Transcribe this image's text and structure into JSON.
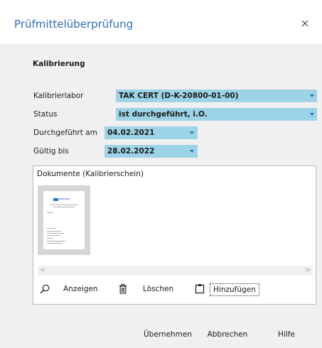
{
  "dialog": {
    "title": "Prüfmittelüberprüfung",
    "close_label": "×"
  },
  "section": {
    "title": "Kalibrierung"
  },
  "fields": {
    "kalibrierlabor": {
      "label": "Kalibrierlabor",
      "value": "TAK CERT (D-K-20800-01-00)"
    },
    "status": {
      "label": "Status",
      "value": "ist durchgeführt, i.O."
    },
    "durchgefuehrt_am": {
      "label": "Durchgeführt am",
      "value": "04.02.2021"
    },
    "gueltig_bis": {
      "label": "Gültig bis",
      "value": "28.02.2022"
    }
  },
  "documents": {
    "title": "Dokumente (Kalibrierschein)",
    "thumbnail_logo": "AZK Plus",
    "scroll_left": "<",
    "scroll_right": ">",
    "actions": {
      "view": "Anzeigen",
      "delete": "Löschen",
      "add": "Hinzufügen"
    }
  },
  "footer": {
    "apply": "Übernehmen",
    "cancel": "Abbrechen",
    "help": "Hilfe"
  },
  "colors": {
    "title_blue": "#2a6db5",
    "combo_fill": "#9dd3e6",
    "arrow_blue": "#1f6fb5"
  }
}
